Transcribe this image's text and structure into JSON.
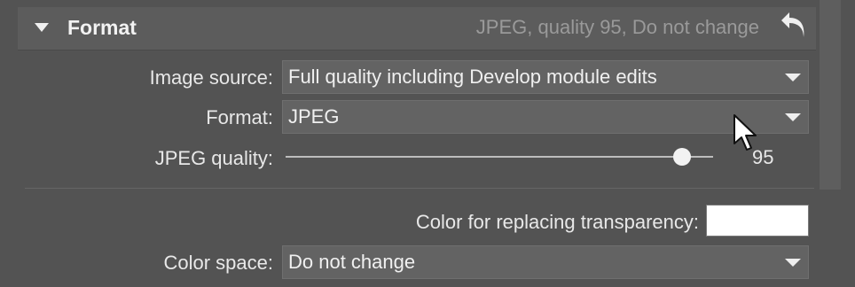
{
  "section": {
    "title": "Format",
    "summary": "JPEG, quality 95, Do not change"
  },
  "image_source": {
    "label": "Image source:",
    "value": "Full quality including Develop module edits"
  },
  "format": {
    "label": "Format:",
    "value": "JPEG"
  },
  "jpeg_quality": {
    "label": "JPEG quality:",
    "value": "95",
    "level": 0.95
  },
  "transparency": {
    "label": "Color for replacing transparency:",
    "color": "#ffffff"
  },
  "color_space": {
    "label": "Color space:",
    "value": "Do not change"
  },
  "icons": {
    "collapse": "triangle-down-icon",
    "reset": "undo-arrow-icon",
    "dropdown": "chevron-down-icon",
    "cursor": "mouse-pointer-icon"
  },
  "colors": {
    "panel_bg": "#535353",
    "header_bg": "#5c5c5c",
    "control_bg": "#636363",
    "summary_text": "#9a9a9a"
  }
}
